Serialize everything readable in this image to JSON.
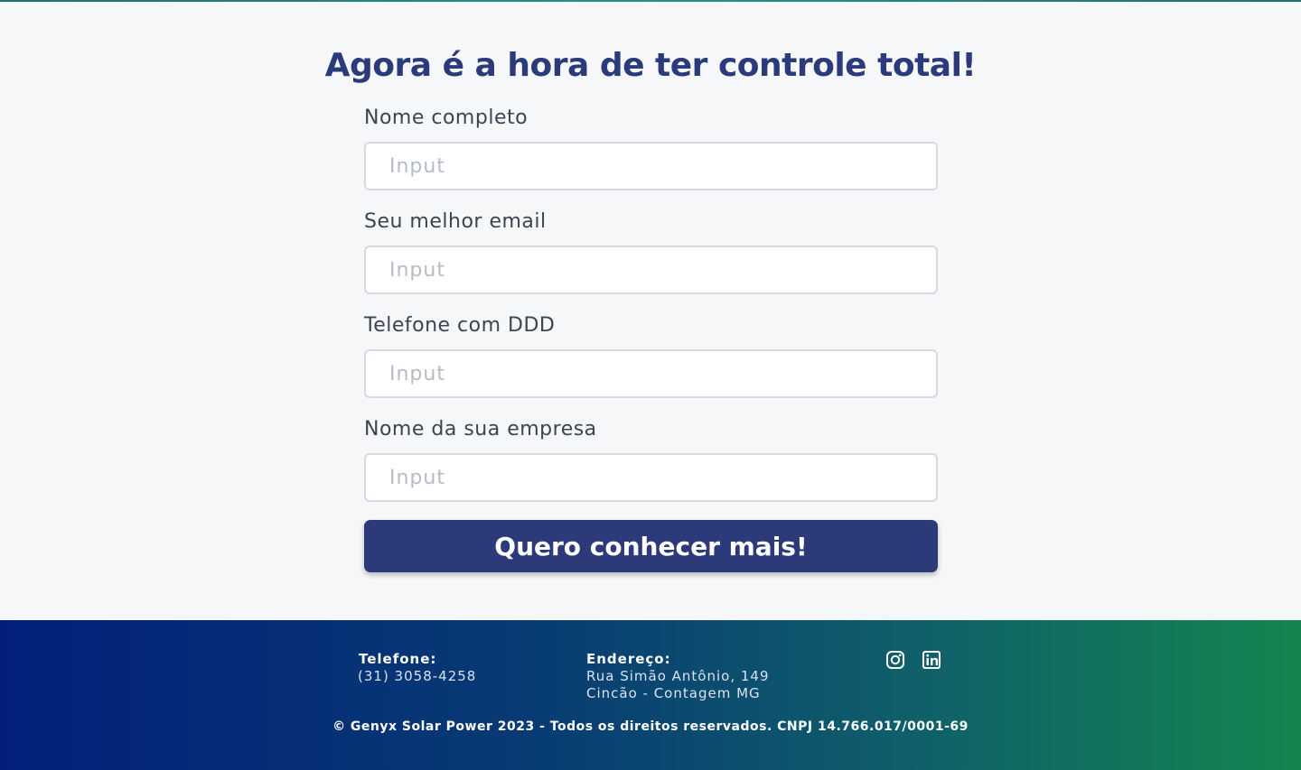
{
  "form": {
    "heading": "Agora é a hora de ter controle total!",
    "fields": [
      {
        "label": "Nome completo",
        "placeholder": "Input",
        "value": ""
      },
      {
        "label": "Seu melhor email",
        "placeholder": "Input",
        "value": ""
      },
      {
        "label": "Telefone com DDD",
        "placeholder": "Input",
        "value": ""
      },
      {
        "label": "Nome da sua empresa",
        "placeholder": "Input",
        "value": ""
      }
    ],
    "submit_label": "Quero conhecer mais!"
  },
  "footer": {
    "phone_label": "Telefone:",
    "phone_value": "(31) 3058-4258",
    "address_label": "Endereço:",
    "address_line1": "Rua Simão Antônio, 149",
    "address_line2": "Cincão - Contagem MG",
    "social_icons": [
      "instagram-icon",
      "linkedin-icon"
    ],
    "copyright": "© Genyx Solar Power 2023 - Todos os direitos reservados. CNPJ 14.766.017/0001-69"
  },
  "colors": {
    "heading": "#2a3a7a",
    "button": "#2c3a7a",
    "footer_start": "#02207a",
    "footer_end": "#15854f"
  }
}
